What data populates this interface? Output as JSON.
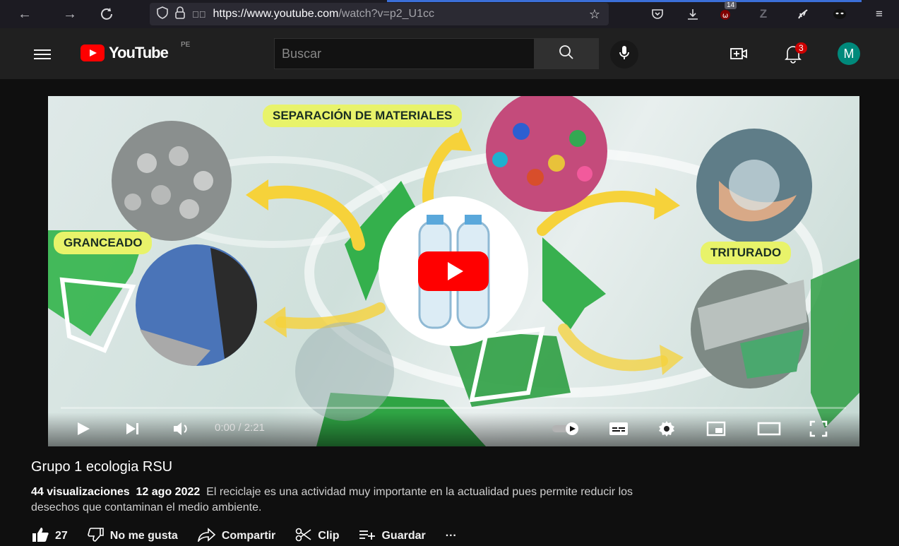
{
  "browser": {
    "url_host": "https://www.youtube.com",
    "url_rest": "/watch?v=p2_U1cc",
    "extension_badge": "14"
  },
  "header": {
    "logo_text": "YouTube",
    "region": "PE",
    "search_placeholder": "Buscar",
    "notification_count": "3",
    "avatar_initial": "M"
  },
  "thumbnail": {
    "labels": {
      "top": "SEPARACIÓN DE MATERIALES",
      "left": "GRANCEADO",
      "right": "TRITURADO"
    }
  },
  "player": {
    "time": "0:00 / 2:21",
    "progress_fraction": 0.0
  },
  "video": {
    "title": "Grupo 1 ecologia RSU",
    "views": "44 visualizaciones",
    "date": "12 ago 2022",
    "description": "El reciclaje es una actividad muy importante en la actualidad pues permite reducir los desechos que contaminan el medio ambiente."
  },
  "actions": {
    "likes": "27",
    "dislike_label": "No me gusta",
    "share_label": "Compartir",
    "clip_label": "Clip",
    "save_label": "Guardar",
    "more_label": "···"
  },
  "colors": {
    "brand_red": "#ff0000",
    "avatar": "#00897b",
    "label_bg": "#e8f36a"
  }
}
